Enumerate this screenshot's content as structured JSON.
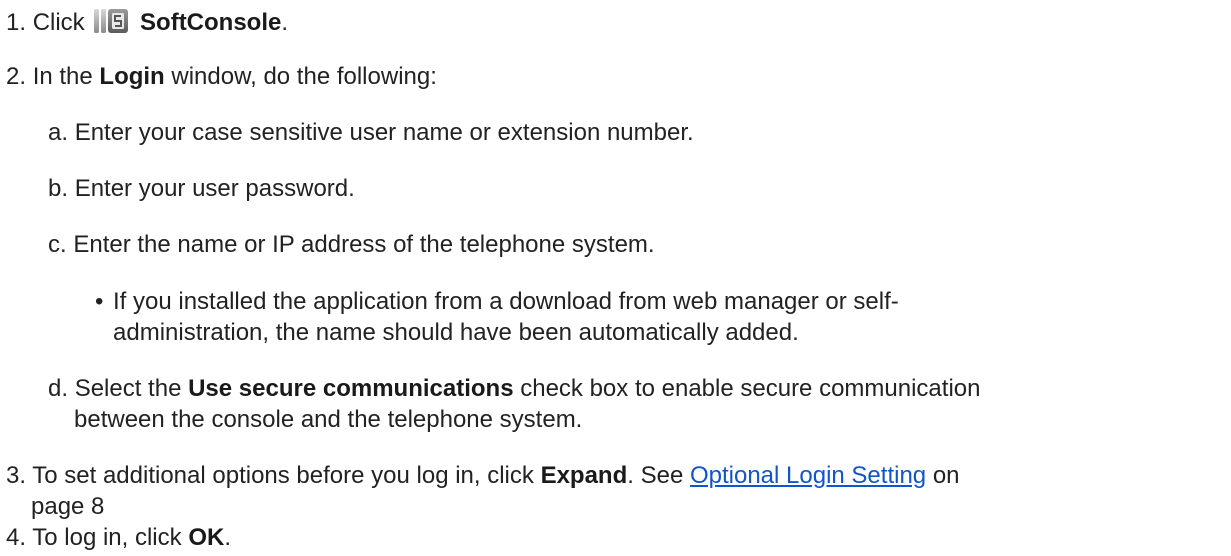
{
  "steps": [
    {
      "number": "1.",
      "text_before": "Click",
      "bold": "SoftConsole",
      "text_after": "."
    },
    {
      "number": "2.",
      "text_before": "In the",
      "bold": "Login",
      "text_after": "window, do the following:",
      "substeps": [
        {
          "letter": "a.",
          "text": "Enter your case sensitive user name or extension number."
        },
        {
          "letter": "b.",
          "text": "Enter your user password."
        },
        {
          "letter": "c.",
          "text": "Enter the name or IP address of the telephone system.",
          "bullet": {
            "line1": "If you installed the application from a download from web manager or self-",
            "line2": "administration, the name should have been automatically added."
          }
        },
        {
          "letter": "d.",
          "text_before": "Select the",
          "bold": "Use secure communications",
          "text_after": "check box to enable secure communication",
          "line2": "between the console and the telephone system."
        }
      ]
    },
    {
      "number": "3.",
      "text_before": "To set additional options before you log in, click",
      "bold": "Expand",
      "text_mid": ". See",
      "link": "Optional Login Setting",
      "text_after": "on",
      "line2": "page 8"
    },
    {
      "number": "4.",
      "text_before": "To log in, click",
      "bold": "OK",
      "text_after": "."
    }
  ],
  "icons": {
    "app_icon": "softconsole-app-icon"
  },
  "colors": {
    "link": "#1155cc",
    "text": "#222222"
  }
}
